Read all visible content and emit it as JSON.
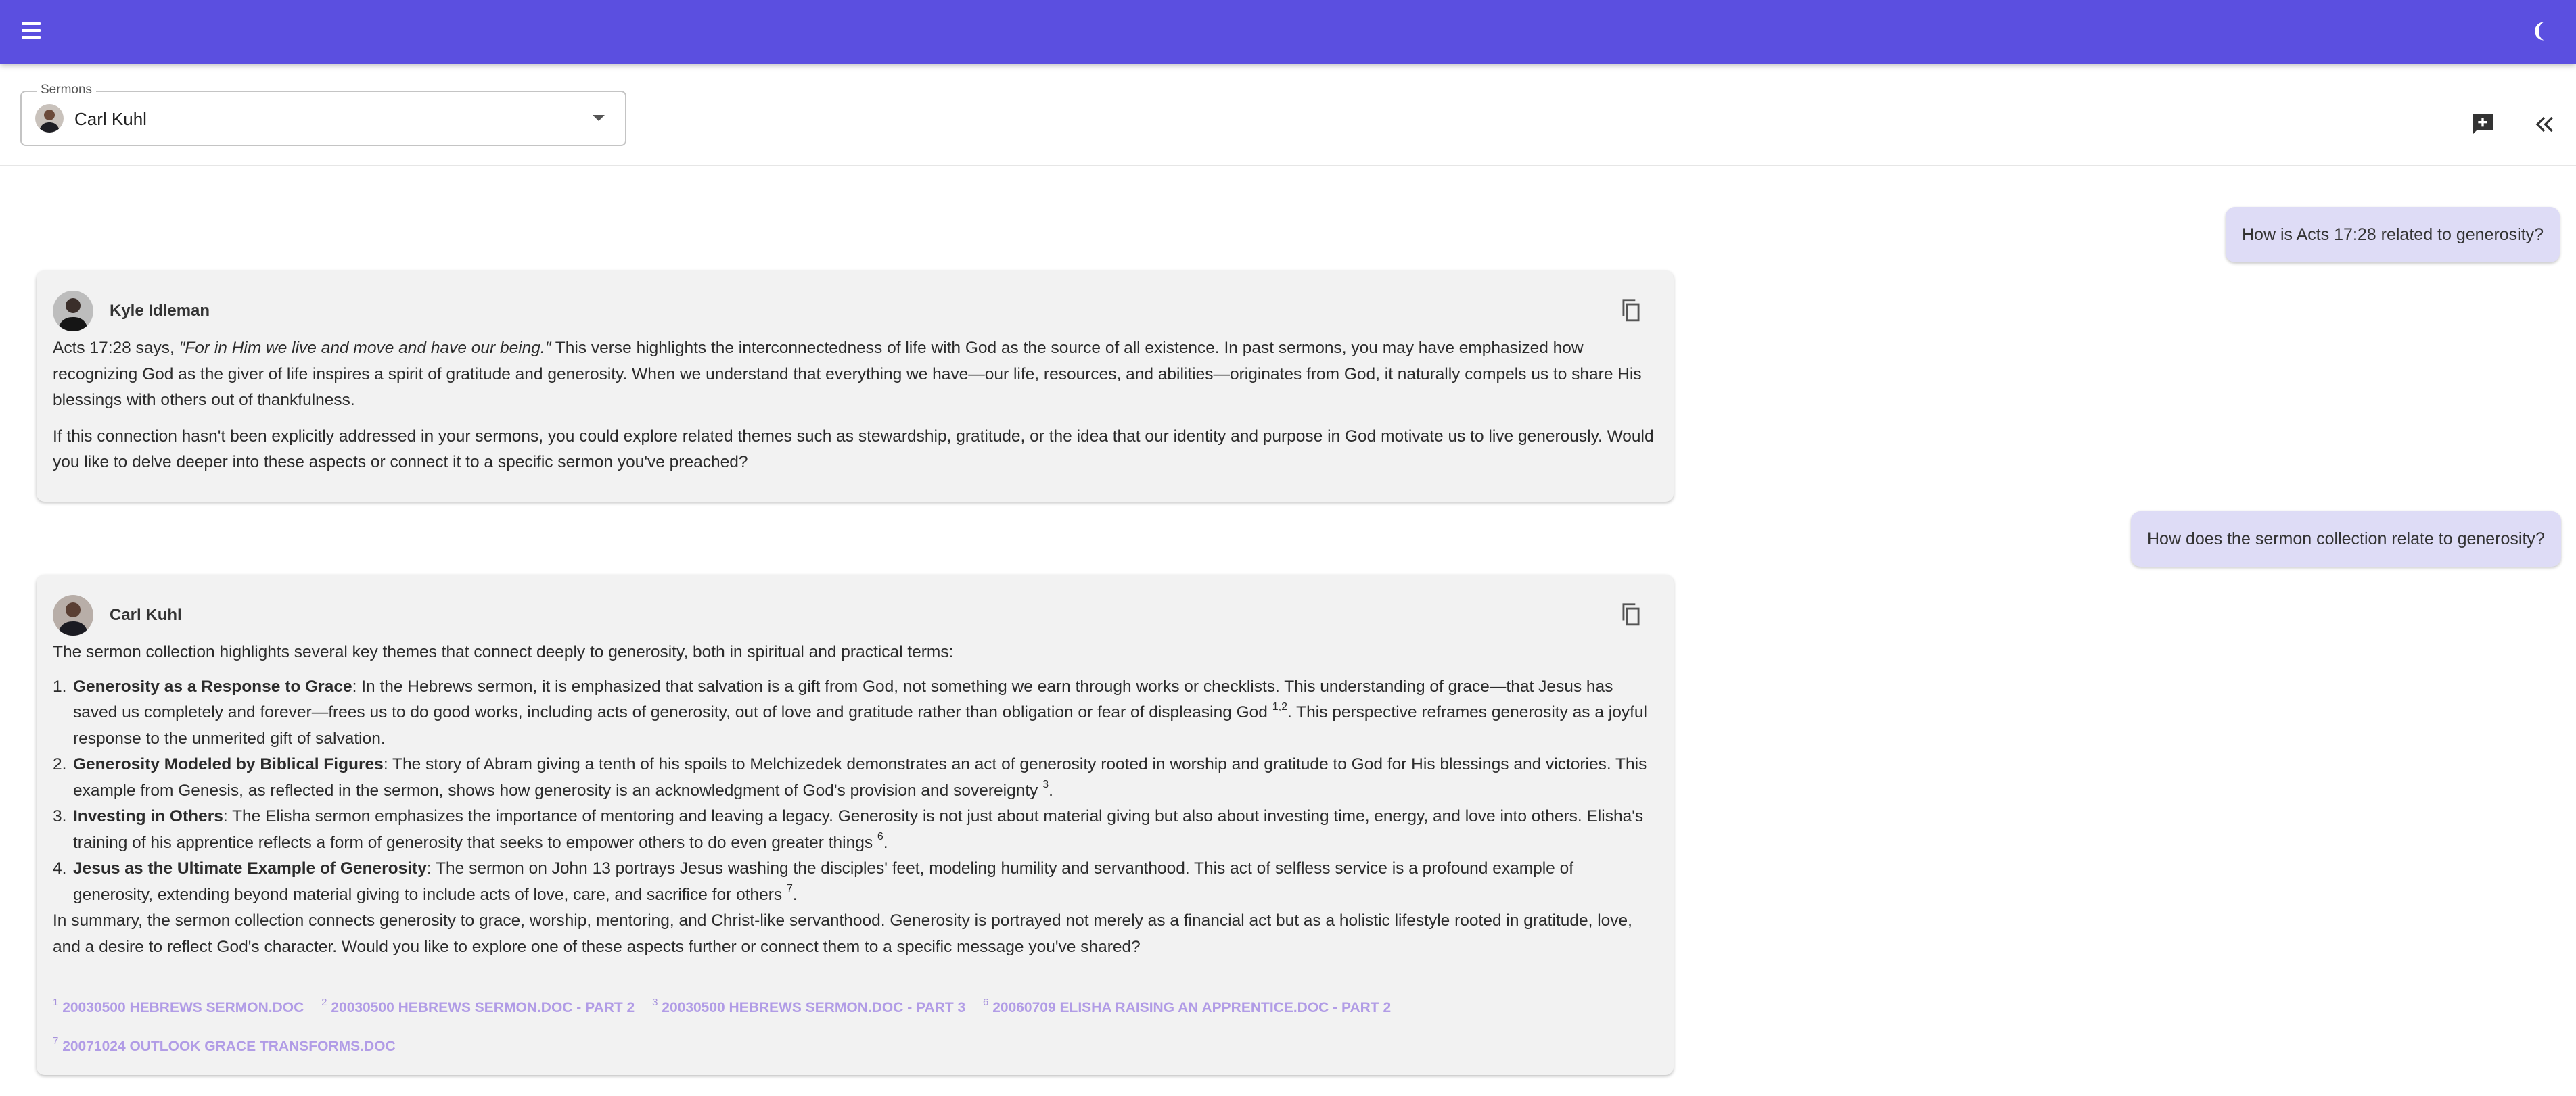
{
  "appbar": {
    "menu_icon": "menu-icon",
    "theme_icon": "dark-mode-moon-icon",
    "color": "#5b4fe0"
  },
  "toolbar": {
    "select_label": "Sermons",
    "selected_value": "Carl Kuhl",
    "new_chat_icon": "add-comment-icon",
    "collapse_icon": "double-chevron-left-icon"
  },
  "messages": [
    {
      "role": "user",
      "text": "How is Acts 17:28 related to generosity?"
    },
    {
      "role": "assistant",
      "name": "Kyle Idleman",
      "p1_pre": "Acts 17:28 says, ",
      "p1_quote": "\"For in Him we live and move and have our being.\"",
      "p1_post": " This verse highlights the interconnectedness of life with God as the source of all existence. In past sermons, you may have emphasized how recognizing God as the giver of life inspires a spirit of gratitude and generosity. When we understand that everything we have—our life, resources, and abilities—originates from God, it naturally compels us to share His blessings with others out of thankfulness.",
      "p2": "If this connection hasn't been explicitly addressed in your sermons, you could explore related themes such as stewardship, gratitude, or the idea that our identity and purpose in God motivate us to live generously. Would you like to delve deeper into these aspects or connect it to a specific sermon you've preached?"
    },
    {
      "role": "user",
      "text": "How does the sermon collection relate to generosity?"
    },
    {
      "role": "assistant",
      "name": "Carl Kuhl",
      "intro": "The sermon collection highlights several key themes that connect deeply to generosity, both in spiritual and practical terms:",
      "items": [
        {
          "num": "1.",
          "title": "Generosity as a Response to Grace",
          "text": ": In the Hebrews sermon, it is emphasized that salvation is a gift from God, not something we earn through works or checklists. This understanding of grace—that Jesus has saved us completely and forever—frees us to do good works, including acts of generosity, out of love and gratitude rather than obligation or fear of displeasing God ",
          "cite": "1,2",
          "after": ". This perspective reframes generosity as a joyful response to the unmerited gift of salvation."
        },
        {
          "num": "2.",
          "title": "Generosity Modeled by Biblical Figures",
          "text": ": The story of Abram giving a tenth of his spoils to Melchizedek demonstrates an act of generosity rooted in worship and gratitude to God for His blessings and victories. This example from Genesis, as reflected in the sermon, shows how generosity is an acknowledgment of God's provision and sovereignty ",
          "cite": "3",
          "after": "."
        },
        {
          "num": "3.",
          "title": "Investing in Others",
          "text": ": The Elisha sermon emphasizes the importance of mentoring and leaving a legacy. Generosity is not just about material giving but also about investing time, energy, and love into others. Elisha's training of his apprentice reflects a form of generosity that seeks to empower others to do even greater things ",
          "cite": "6",
          "after": "."
        },
        {
          "num": "4.",
          "title": "Jesus as the Ultimate Example of Generosity",
          "text": ": The sermon on John 13 portrays Jesus washing the disciples' feet, modeling humility and servanthood. This act of selfless service is a profound example of generosity, extending beyond material giving to include acts of love, care, and sacrifice for others ",
          "cite": "7",
          "after": "."
        }
      ],
      "summary": "In summary, the sermon collection connects generosity to grace, worship, mentoring, and Christ-like servanthood. Generosity is portrayed not merely as a financial act but as a holistic lifestyle rooted in gratitude, love, and a desire to reflect God's character. Would you like to explore one of these aspects further or connect them to a specific message you've shared?",
      "references": [
        {
          "num": "1",
          "label": "20030500 HEBREWS SERMON.DOC"
        },
        {
          "num": "2",
          "label": "20030500 HEBREWS SERMON.DOC - PART 2"
        },
        {
          "num": "3",
          "label": "20030500 HEBREWS SERMON.DOC - PART 3"
        },
        {
          "num": "6",
          "label": "20060709 ELISHA RAISING AN APPRENTICE.DOC - PART 2"
        },
        {
          "num": "7",
          "label": "20071024 OUTLOOK GRACE TRANSFORMS.DOC"
        }
      ]
    }
  ],
  "copy_icon": "copy-icon"
}
